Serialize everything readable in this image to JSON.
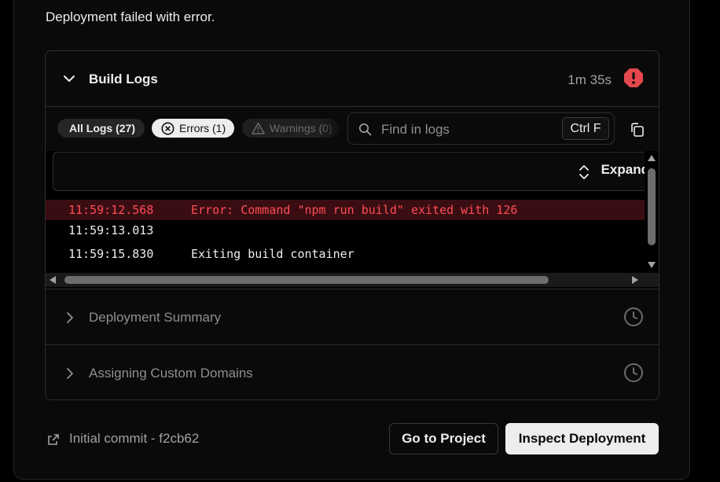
{
  "status": {
    "message": "Deployment failed with error."
  },
  "build_logs": {
    "title": "Build Logs",
    "duration": "1m 35s",
    "filters": {
      "all_label": "All Logs (27)",
      "errors_label": "Errors (1)",
      "warnings_label": "Warnings (0)"
    },
    "search": {
      "placeholder": "Find in logs",
      "shortcut": "Ctrl F"
    },
    "expand_label": "Expand",
    "lines": [
      {
        "time": "11:59:12.568",
        "message": "Error: Command \"npm run build\" exited with 126",
        "level": "error"
      },
      {
        "time": "11:59:13.013",
        "message": "",
        "level": "info"
      },
      {
        "time": "11:59:15.830",
        "message": "Exiting build container",
        "level": "info"
      }
    ]
  },
  "sections": [
    {
      "label": "Deployment Summary"
    },
    {
      "label": "Assigning Custom Domains"
    }
  ],
  "footer": {
    "commit_text": "Initial commit - f2cb62",
    "go_to_project": "Go to Project",
    "inspect_deployment": "Inspect Deployment"
  },
  "colors": {
    "error": "#ff4d55",
    "error_badge": "#e5484d",
    "background": "#0a0a0a",
    "border": "#2e2e2e"
  },
  "icons": [
    "chevron-down-icon",
    "error-badge-icon",
    "x-circle-icon",
    "warning-triangle-icon",
    "search-icon",
    "copy-icon",
    "expand-chevrons-icon",
    "chevron-right-icon",
    "clock-icon",
    "external-link-icon"
  ]
}
